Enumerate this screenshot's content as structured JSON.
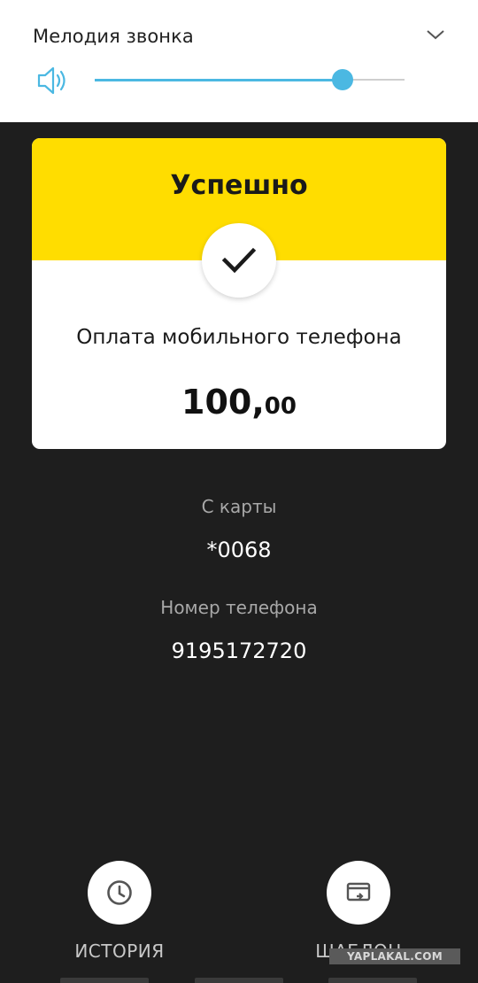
{
  "volume": {
    "title": "Мелодия звонка",
    "level": 0.8,
    "accent_color": "#4bb8e2",
    "speaker_icon": "speaker-icon",
    "expand_icon": "chevron-down-icon"
  },
  "receipt": {
    "status": "Успешно",
    "status_color": "#ffdd00",
    "status_icon": "checkmark-icon",
    "payment_name": "Оплата мобильного телефона",
    "amount_integer": "100",
    "amount_separator": ",",
    "amount_fraction": "00"
  },
  "details": [
    {
      "label": "С карты",
      "value": "*0068"
    },
    {
      "label": "Номер телефона",
      "value": "9195172720"
    }
  ],
  "actions": {
    "history": {
      "label": "ИСТОРИЯ",
      "icon": "clock-icon"
    },
    "template": {
      "label": "ШАБЛОН",
      "icon": "template-icon"
    }
  },
  "watermark": "YAPLAKAL.COM"
}
